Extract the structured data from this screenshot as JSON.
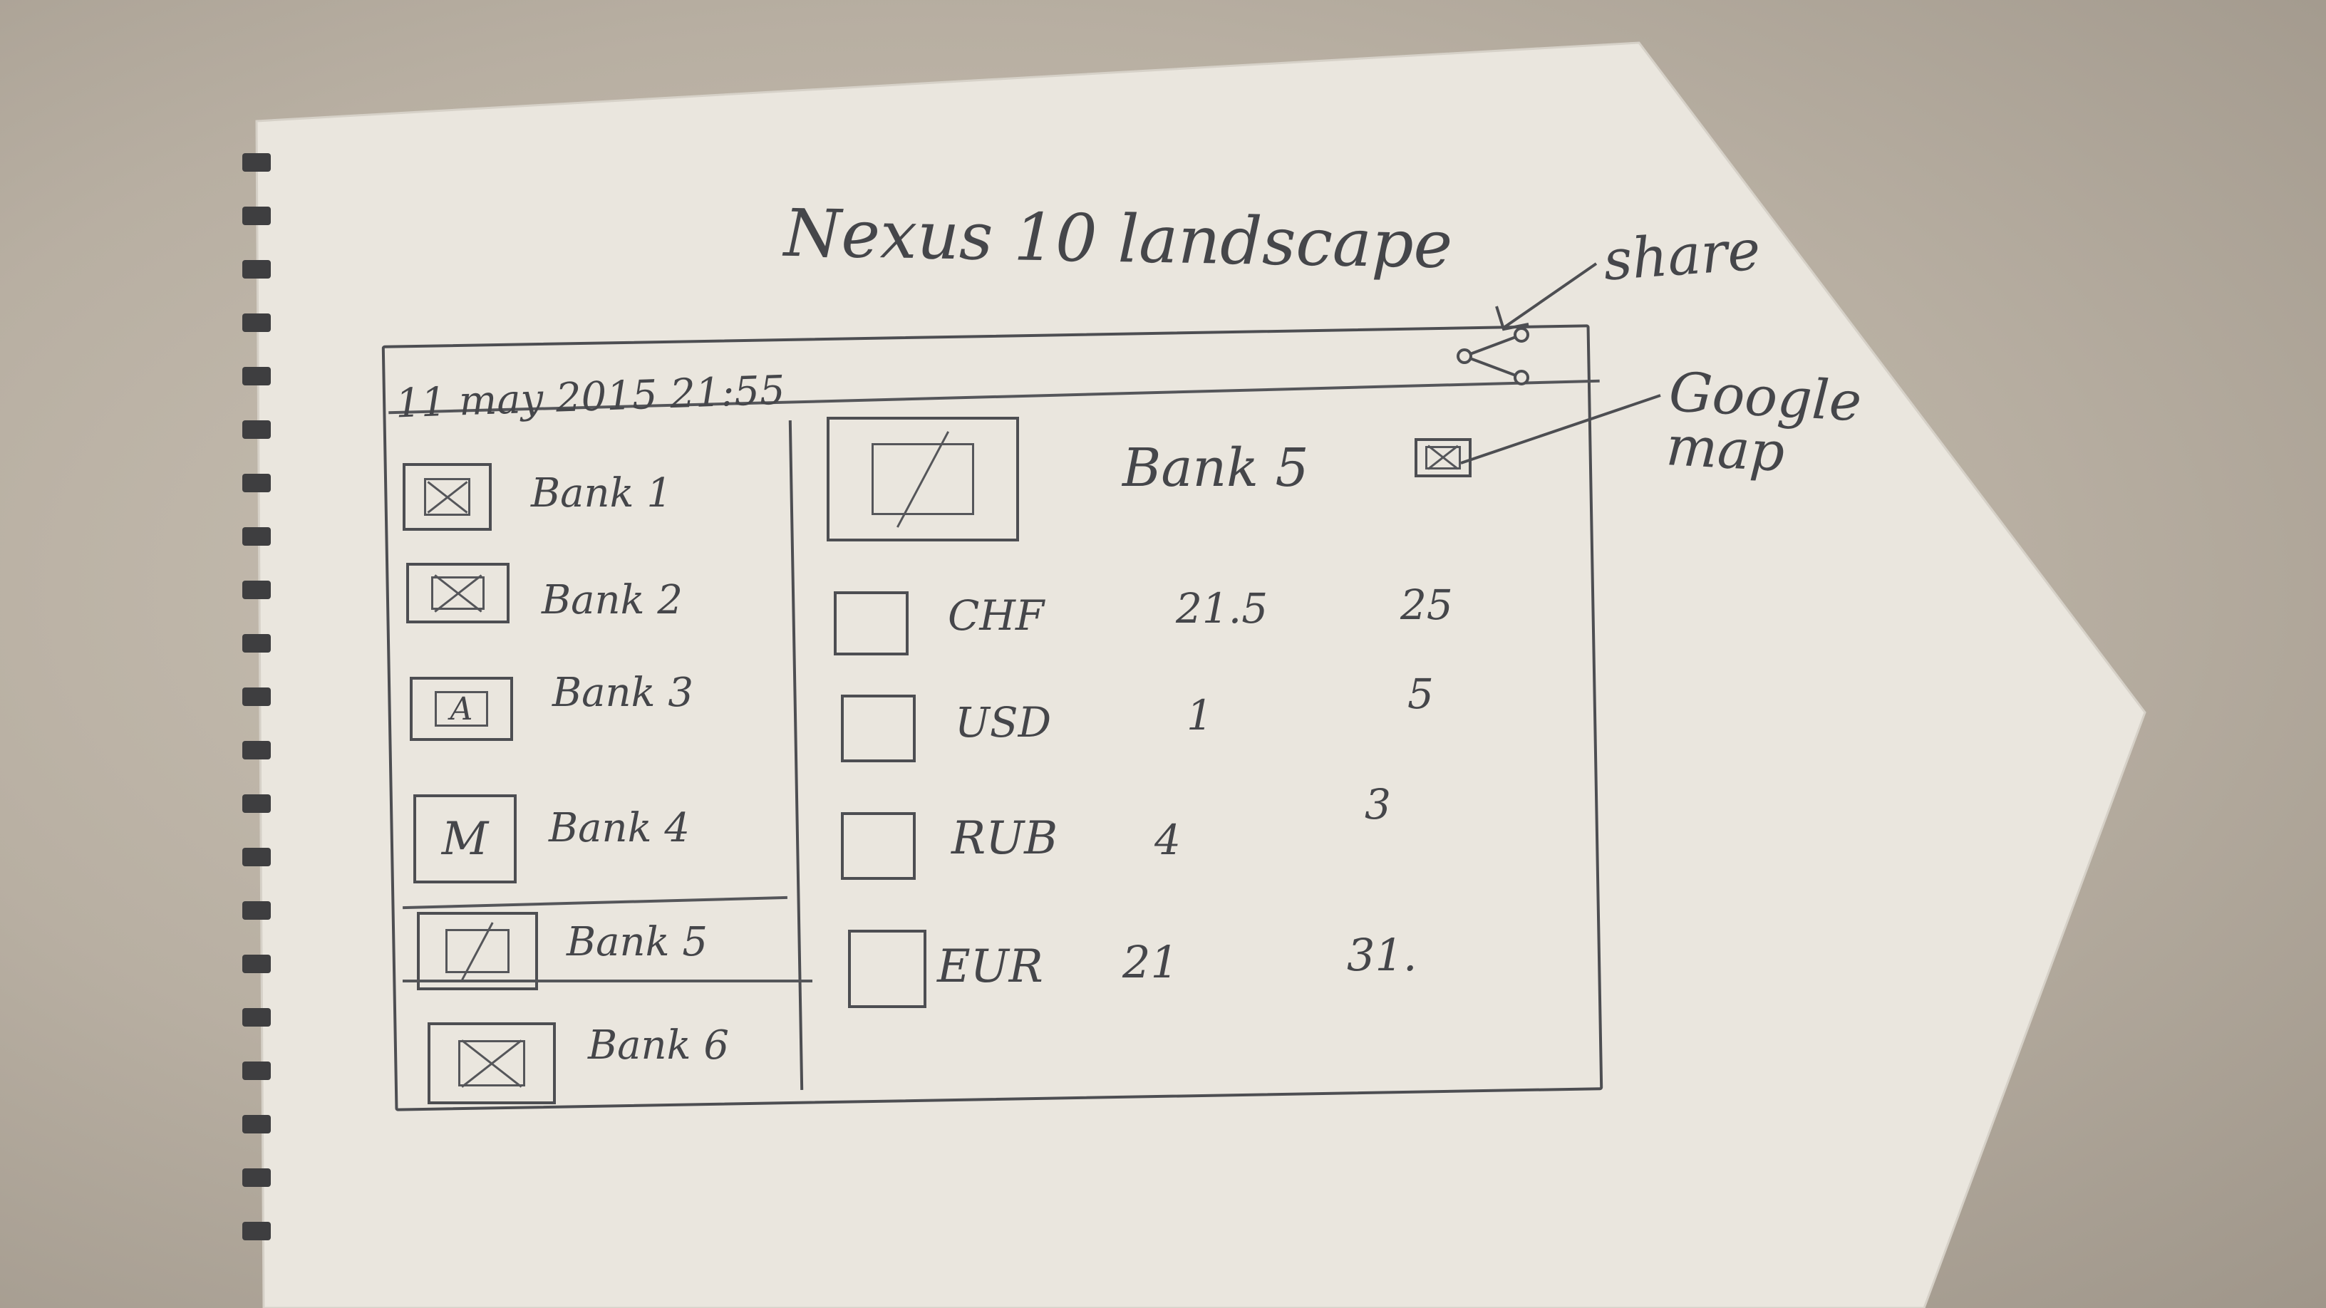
{
  "sketch": {
    "title": "Nexus 10 landscape",
    "share_annotation": "share",
    "map_annotation": "Google map",
    "datetime": "11 may 2015 21:55",
    "sidebar": {
      "items": [
        {
          "label": "Bank 1",
          "icon": "image-placeholder-icon"
        },
        {
          "label": "Bank 2",
          "icon": "image-placeholder-icon"
        },
        {
          "label": "Bank 3",
          "icon": "logo-a-icon",
          "letter": "A"
        },
        {
          "label": "Bank 4",
          "icon": "logo-m-icon",
          "letter": "M"
        },
        {
          "label": "Bank 5",
          "icon": "logo-v-icon",
          "selected": true
        },
        {
          "label": "Bank 6",
          "icon": "image-placeholder-icon"
        }
      ]
    },
    "detail": {
      "bank_name": "Bank 5",
      "rows": [
        {
          "currency": "CHF",
          "buy": "21.5",
          "sell": "25"
        },
        {
          "currency": "USD",
          "buy": "1",
          "sell": "5"
        },
        {
          "currency": "RUB",
          "buy": "4",
          "sell": "3"
        },
        {
          "currency": "EUR",
          "buy": "21",
          "sell": "31."
        }
      ]
    }
  },
  "colors": {
    "ink": "#4d4e52",
    "paper": "#ebe7df",
    "background": "#b8afa2"
  }
}
